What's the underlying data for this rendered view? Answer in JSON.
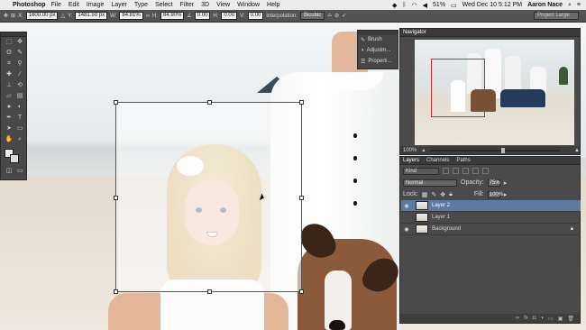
{
  "menubar": {
    "app": "Photoshop",
    "items": [
      "File",
      "Edit",
      "Image",
      "Layer",
      "Type",
      "Select",
      "Filter",
      "3D",
      "View",
      "Window",
      "Help"
    ],
    "battery": "51%",
    "clock": "Wed Dec 10  5:12 PM",
    "user": "Aaron Nace"
  },
  "options": {
    "x_label": "X:",
    "x_value": "1600.00 px",
    "y_label": "Y:",
    "y_value": "1481.50 px",
    "w_label": "W:",
    "w_value": "84.81%",
    "h_label": "H:",
    "h_value": "84.90%",
    "angle_value": "0.00",
    "hskew_label": "H:",
    "hskew_value": "0.00",
    "vskew_label": "V:",
    "vskew_value": "0.00",
    "interpolation_label": "Interpolation:",
    "interpolation_value": "Bicubic",
    "workspace": "Project Large"
  },
  "mini_panel": {
    "items": [
      "Brush",
      "Adjustm...",
      "Properti..."
    ]
  },
  "navigator": {
    "tab": "Navigator",
    "zoom": "100%"
  },
  "layers": {
    "tabs": [
      "Layers",
      "Channels",
      "Paths"
    ],
    "kind": "Kind",
    "blend_mode": "Normal",
    "opacity_label": "Opacity:",
    "opacity": "75%",
    "lock_label": "Lock:",
    "fill_label": "Fill:",
    "fill": "100%",
    "items": [
      {
        "name": "Layer 2",
        "selected": true
      },
      {
        "name": "Layer 1",
        "selected": false
      },
      {
        "name": "Background",
        "selected": false,
        "locked": true
      }
    ]
  }
}
